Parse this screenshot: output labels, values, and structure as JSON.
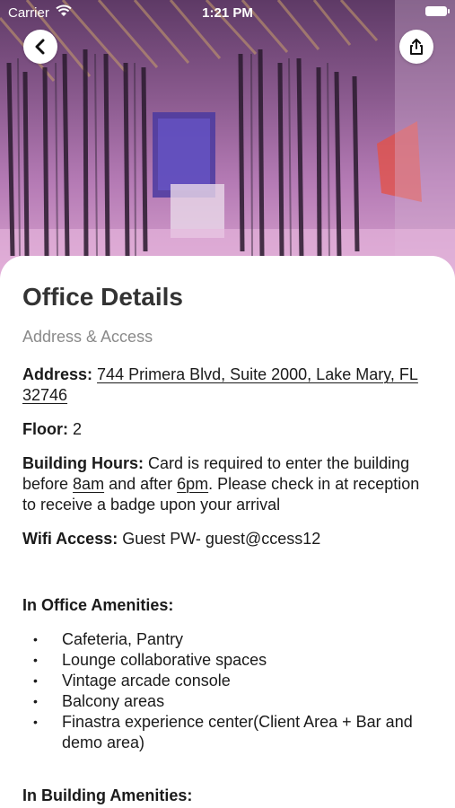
{
  "status_bar": {
    "carrier": "Carrier",
    "time": "1:21 PM"
  },
  "header": {
    "back_icon": "chevron-left-icon",
    "share_icon": "share-icon"
  },
  "details": {
    "title": "Office Details",
    "subtitle": "Address & Access",
    "address_label": "Address:",
    "address_value": "744 Primera Blvd, Suite 2000, Lake Mary, FL 32746",
    "floor_label": "Floor:",
    "floor_value": "2",
    "hours_label": "Building Hours:",
    "hours_text_1": "Card is required to enter the building before ",
    "hours_time_1": "8am",
    "hours_text_2": " and after ",
    "hours_time_2": "6pm",
    "hours_text_3": ". Please check in at reception to receive a badge upon your arrival",
    "wifi_label": "Wifi Access:",
    "wifi_value": "Guest PW- guest@ccess12"
  },
  "in_office": {
    "heading": "In Office Amenities:",
    "items": [
      "Cafeteria, Pantry",
      "Lounge collaborative spaces",
      "Vintage arcade console",
      "Balcony areas",
      "Finastra experience center(Client Area + Bar and demo area)"
    ]
  },
  "in_building": {
    "heading": "In Building Amenities:"
  },
  "colors": {
    "hero_tint": "#8a5a8e",
    "text": "#1a1a1a",
    "muted": "#8a8a8a"
  }
}
